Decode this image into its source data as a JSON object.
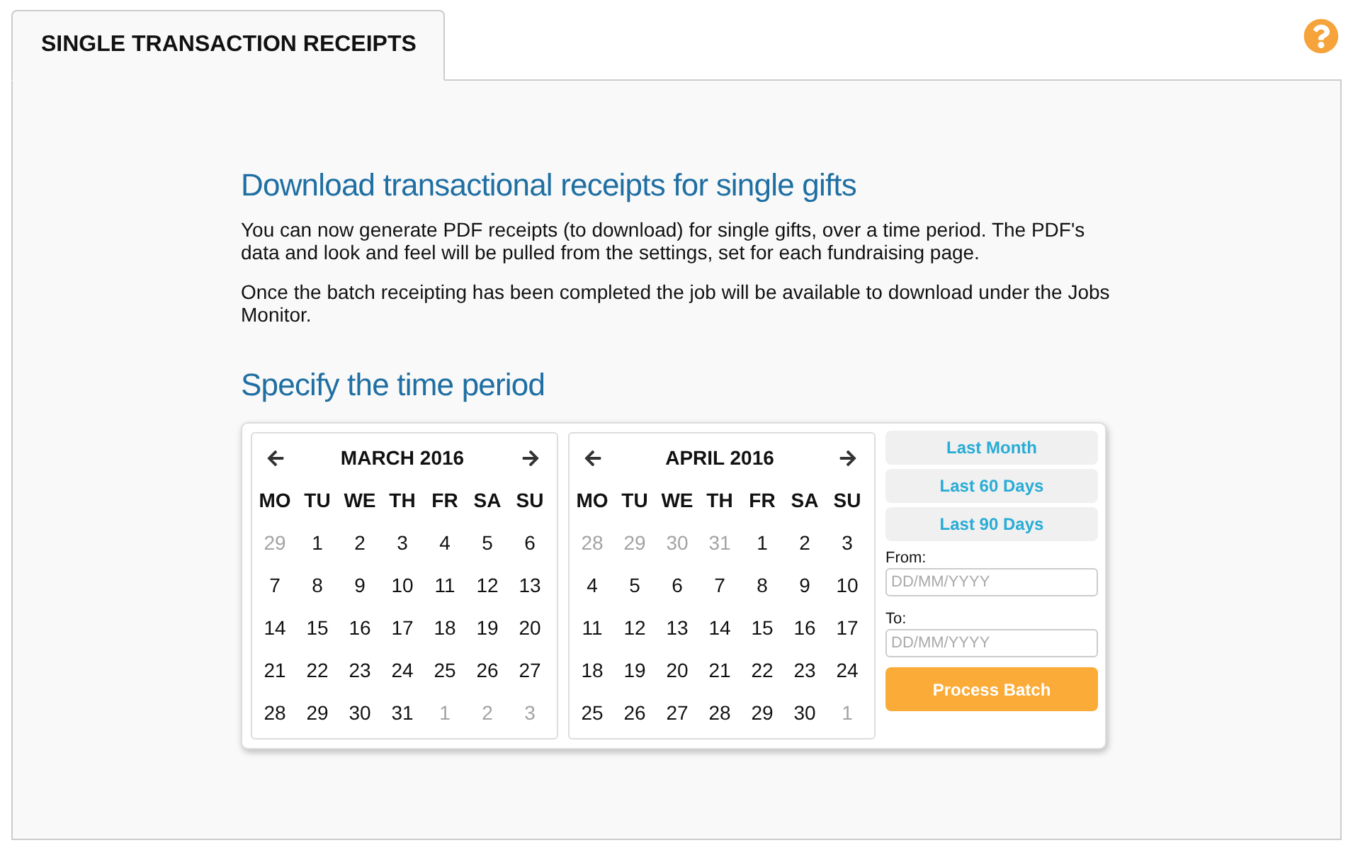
{
  "tabs": [
    {
      "label": "SINGLE TRANSACTION RECEIPTS",
      "selected": true
    }
  ],
  "intro": {
    "heading": "Download transactional receipts for single gifts",
    "paragraphs": [
      "You can now generate PDF receipts (to download) for single gifts, over a time period. The PDF's data and look and feel will be pulled from the settings, set for each fundraising page.",
      "Once the batch receipting has been completed the job will be available to download under the Jobs Monitor."
    ]
  },
  "time_period": {
    "heading": "Specify the time period",
    "calendars": [
      {
        "title": "MARCH 2016",
        "weekdays": [
          "MO",
          "TU",
          "WE",
          "TH",
          "FR",
          "SA",
          "SU"
        ],
        "days": [
          {
            "label": "29",
            "muted": true
          },
          {
            "label": "1",
            "muted": false
          },
          {
            "label": "2",
            "muted": false
          },
          {
            "label": "3",
            "muted": false
          },
          {
            "label": "4",
            "muted": false
          },
          {
            "label": "5",
            "muted": false
          },
          {
            "label": "6",
            "muted": false
          },
          {
            "label": "7",
            "muted": false
          },
          {
            "label": "8",
            "muted": false
          },
          {
            "label": "9",
            "muted": false
          },
          {
            "label": "10",
            "muted": false
          },
          {
            "label": "11",
            "muted": false
          },
          {
            "label": "12",
            "muted": false
          },
          {
            "label": "13",
            "muted": false
          },
          {
            "label": "14",
            "muted": false
          },
          {
            "label": "15",
            "muted": false
          },
          {
            "label": "16",
            "muted": false
          },
          {
            "label": "17",
            "muted": false
          },
          {
            "label": "18",
            "muted": false
          },
          {
            "label": "19",
            "muted": false
          },
          {
            "label": "20",
            "muted": false
          },
          {
            "label": "21",
            "muted": false
          },
          {
            "label": "22",
            "muted": false
          },
          {
            "label": "23",
            "muted": false
          },
          {
            "label": "24",
            "muted": false
          },
          {
            "label": "25",
            "muted": false
          },
          {
            "label": "26",
            "muted": false
          },
          {
            "label": "27",
            "muted": false
          },
          {
            "label": "28",
            "muted": false
          },
          {
            "label": "29",
            "muted": false
          },
          {
            "label": "30",
            "muted": false
          },
          {
            "label": "31",
            "muted": false
          },
          {
            "label": "1",
            "muted": true
          },
          {
            "label": "2",
            "muted": true
          },
          {
            "label": "3",
            "muted": true
          }
        ]
      },
      {
        "title": "APRIL 2016",
        "weekdays": [
          "MO",
          "TU",
          "WE",
          "TH",
          "FR",
          "SA",
          "SU"
        ],
        "days": [
          {
            "label": "28",
            "muted": true
          },
          {
            "label": "29",
            "muted": true
          },
          {
            "label": "30",
            "muted": true
          },
          {
            "label": "31",
            "muted": true
          },
          {
            "label": "1",
            "muted": false
          },
          {
            "label": "2",
            "muted": false
          },
          {
            "label": "3",
            "muted": false
          },
          {
            "label": "4",
            "muted": false
          },
          {
            "label": "5",
            "muted": false
          },
          {
            "label": "6",
            "muted": false
          },
          {
            "label": "7",
            "muted": false
          },
          {
            "label": "8",
            "muted": false
          },
          {
            "label": "9",
            "muted": false
          },
          {
            "label": "10",
            "muted": false
          },
          {
            "label": "11",
            "muted": false
          },
          {
            "label": "12",
            "muted": false
          },
          {
            "label": "13",
            "muted": false
          },
          {
            "label": "14",
            "muted": false
          },
          {
            "label": "15",
            "muted": false
          },
          {
            "label": "16",
            "muted": false
          },
          {
            "label": "17",
            "muted": false
          },
          {
            "label": "18",
            "muted": false
          },
          {
            "label": "19",
            "muted": false
          },
          {
            "label": "20",
            "muted": false
          },
          {
            "label": "21",
            "muted": false
          },
          {
            "label": "22",
            "muted": false
          },
          {
            "label": "23",
            "muted": false
          },
          {
            "label": "24",
            "muted": false
          },
          {
            "label": "25",
            "muted": false
          },
          {
            "label": "26",
            "muted": false
          },
          {
            "label": "27",
            "muted": false
          },
          {
            "label": "28",
            "muted": false
          },
          {
            "label": "29",
            "muted": false
          },
          {
            "label": "30",
            "muted": false
          },
          {
            "label": "1",
            "muted": true
          }
        ]
      }
    ],
    "presets": [
      {
        "label": "Last Month"
      },
      {
        "label": "Last 60 Days"
      },
      {
        "label": "Last 90 Days"
      }
    ],
    "fields": [
      {
        "label": "From:",
        "placeholder": "DD/MM/YYYY"
      },
      {
        "label": "To:",
        "placeholder": "DD/MM/YYYY"
      }
    ],
    "submit": {
      "label": "Process Batch"
    }
  }
}
